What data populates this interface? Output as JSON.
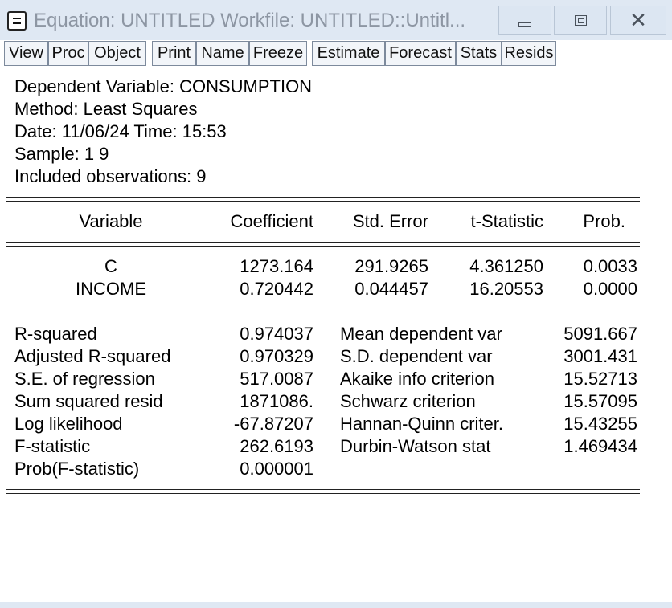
{
  "window": {
    "title": "Equation: UNTITLED   Workfile: UNTITLED::Untitl..."
  },
  "toolbar": {
    "buttons": [
      "View",
      "Proc",
      "Object",
      "Print",
      "Name",
      "Freeze",
      "Estimate",
      "Forecast",
      "Stats",
      "Resids"
    ]
  },
  "header": {
    "dependent": "Dependent Variable: CONSUMPTION",
    "method": "Method: Least Squares",
    "datetime": "Date: 11/06/24   Time: 15:53",
    "sample": "Sample: 1 9",
    "observations": "Included observations: 9"
  },
  "coef_table": {
    "columns": [
      "Variable",
      "Coefficient",
      "Std. Error",
      "t-Statistic",
      "Prob."
    ],
    "rows": [
      [
        "C",
        "1273.164",
        "291.9265",
        "4.361250",
        "0.0033"
      ],
      [
        "INCOME",
        "0.720442",
        "0.044457",
        "16.20553",
        "0.0000"
      ]
    ]
  },
  "stats": {
    "left": [
      [
        "R-squared",
        "0.974037"
      ],
      [
        "Adjusted R-squared",
        "0.970329"
      ],
      [
        "S.E. of regression",
        "517.0087"
      ],
      [
        "Sum squared resid",
        "1871086."
      ],
      [
        "Log likelihood",
        "-67.87207"
      ],
      [
        "F-statistic",
        "262.6193"
      ],
      [
        "Prob(F-statistic)",
        "0.000001"
      ]
    ],
    "right": [
      [
        "Mean dependent var",
        "5091.667"
      ],
      [
        "S.D. dependent var",
        "3001.431"
      ],
      [
        "Akaike info criterion",
        "15.52713"
      ],
      [
        "Schwarz criterion",
        "15.57095"
      ],
      [
        "Hannan-Quinn criter.",
        "15.43255"
      ],
      [
        "Durbin-Watson stat",
        "1.469434"
      ]
    ]
  }
}
